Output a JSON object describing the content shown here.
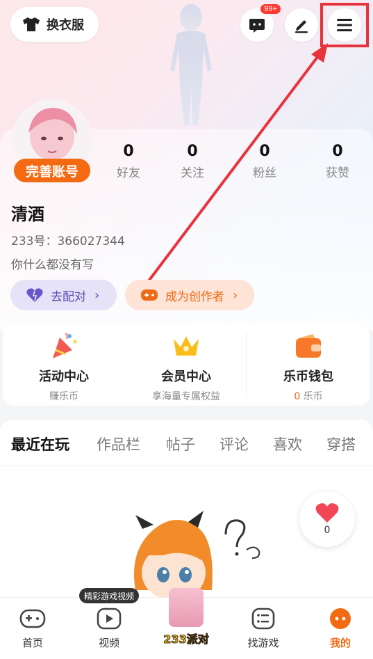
{
  "header": {
    "outfit_label": "换衣服",
    "message_badge": "99+",
    "icons": [
      "outfit-icon",
      "message-icon",
      "edit-icon",
      "menu-icon"
    ]
  },
  "profile": {
    "complete_account": "完善账号",
    "stats": [
      {
        "value": "0",
        "label": "好友"
      },
      {
        "value": "0",
        "label": "关注"
      },
      {
        "value": "0",
        "label": "粉丝"
      },
      {
        "value": "0",
        "label": "获赞"
      }
    ],
    "name": "清酒",
    "id_line": "233号：366027344",
    "bio": "你什么都没有写",
    "pair_label": "去配对",
    "creator_label": "成为创作者"
  },
  "features": [
    {
      "title": "活动中心",
      "sub": "赚乐币"
    },
    {
      "title": "会员中心",
      "sub": "享海量专属权益"
    },
    {
      "title": "乐币钱包",
      "sub_value": "0",
      "sub_unit": "乐币"
    }
  ],
  "tabs": [
    "最近在玩",
    "作品栏",
    "帖子",
    "评论",
    "喜欢",
    "穿搭"
  ],
  "like_count": "0",
  "tabbar": {
    "tooltip": "精彩游戏视频",
    "items": [
      "首页",
      "视频",
      "找游戏",
      "我的"
    ],
    "party_logo": "233派对"
  },
  "colors": {
    "accent": "#f46a12",
    "highlight": "#e8323c",
    "pair": "#5b4bb8"
  }
}
